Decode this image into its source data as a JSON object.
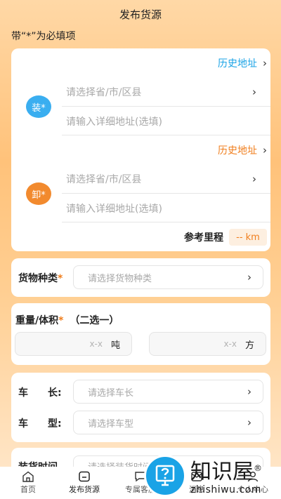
{
  "header": {
    "title": "发布货源"
  },
  "required_note": "带“*”为必填项",
  "load": {
    "history_label": "历史地址",
    "badge": "装*",
    "region_placeholder": "请选择省/市/区县",
    "detail_placeholder": "请输入详细地址(选填)"
  },
  "unload": {
    "history_label": "历史地址",
    "badge": "卸*",
    "region_placeholder": "请选择省/市/区县",
    "detail_placeholder": "请输入详细地址(选填)"
  },
  "mileage": {
    "label": "参考里程",
    "value": "-- km"
  },
  "goods": {
    "label": "货物种类",
    "star": "*",
    "placeholder": "请选择货物种类"
  },
  "weight": {
    "label": "重量/体积",
    "star": "*",
    "hint": "（二选一）",
    "weight_placeholder": "x-x",
    "weight_unit": "吨",
    "volume_placeholder": "x-x",
    "volume_unit": "方"
  },
  "vehicle": {
    "length_label": "车　　长:",
    "length_placeholder": "请选择车长",
    "type_label": "车　　型:",
    "type_placeholder": "请选择车型"
  },
  "loading_time": {
    "label": "装货时间",
    "placeholder": "请选择装货时间"
  },
  "tabbar": [
    {
      "label": "首页",
      "icon": "home-icon"
    },
    {
      "label": "发布货源",
      "icon": "publish-icon"
    },
    {
      "label": "专属客服",
      "icon": "chat-icon"
    },
    {
      "label": "消息",
      "icon": "message-icon"
    },
    {
      "label": "个人中心",
      "icon": "user-icon"
    }
  ],
  "watermark": {
    "main": "知识屋",
    "sub": "zhishiwu.com",
    "mark": "®"
  },
  "colors": {
    "accent_blue": "#1aa3e6",
    "accent_orange": "#f07e1d"
  },
  "chevron": "›"
}
